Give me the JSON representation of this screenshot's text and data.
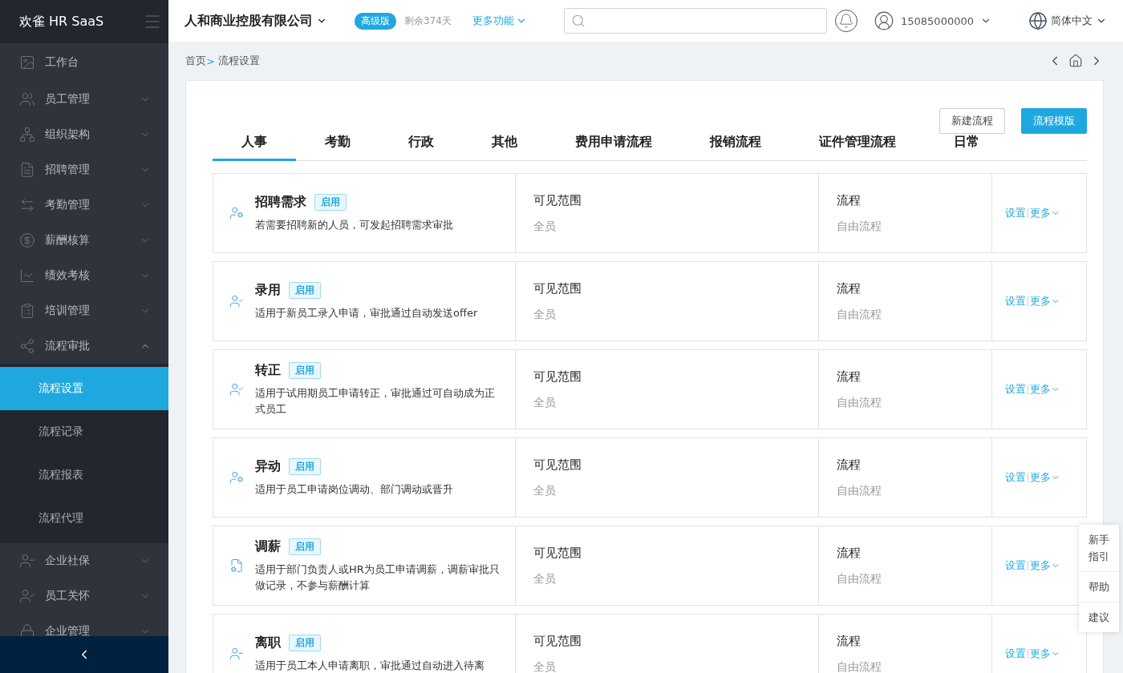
{
  "sidebar": {
    "logo": "欢雀 HR SaaS",
    "items": [
      {
        "label": "工作台"
      },
      {
        "label": "员工管理",
        "expanded": false
      },
      {
        "label": "组织架构",
        "expanded": false
      },
      {
        "label": "招聘管理",
        "expanded": false
      },
      {
        "label": "考勤管理",
        "expanded": false
      },
      {
        "label": "薪酬核算",
        "expanded": false
      },
      {
        "label": "绩效考核",
        "expanded": false
      },
      {
        "label": "培训管理",
        "expanded": false
      },
      {
        "label": "流程审批",
        "expanded": true,
        "children": [
          {
            "label": "流程设置",
            "selected": true
          },
          {
            "label": "流程记录",
            "selected": false
          },
          {
            "label": "流程报表",
            "selected": false
          },
          {
            "label": "流程代理",
            "selected": false
          }
        ]
      },
      {
        "label": "企业社保",
        "expanded": false
      },
      {
        "label": "员工关怀",
        "expanded": false
      },
      {
        "label": "企业管理",
        "expanded": false
      }
    ]
  },
  "header": {
    "company": "人和商业控股有限公司",
    "edition": "高级版",
    "remaining": "剩余374天",
    "more_features": "更多功能",
    "account": "15085000000",
    "language": "简体中文"
  },
  "breadcrumb": {
    "items": [
      "首页",
      "流程设置"
    ],
    "separator": ">"
  },
  "buttons": [
    {
      "label": "新建流程",
      "kind": "default"
    },
    {
      "label": "流程模版",
      "kind": "primary"
    }
  ],
  "tabs": [
    {
      "label": "人事",
      "selected": true
    },
    {
      "label": "考勤",
      "selected": false
    },
    {
      "label": "行政",
      "selected": false
    },
    {
      "label": "其他",
      "selected": false
    },
    {
      "label": "费用申请流程",
      "selected": false
    },
    {
      "label": "报销流程",
      "selected": false
    },
    {
      "label": "证件管理流程",
      "selected": false
    },
    {
      "label": "日常",
      "selected": false
    }
  ],
  "flows": [
    {
      "name": "招聘需求",
      "status": "启用",
      "description": "若需要招聘新的人员，可发起招聘需求审批",
      "scope_label": "可见范围",
      "scope": "全员",
      "type_label": "流程",
      "type": "自由流程",
      "actions": [
        "设置",
        "更多"
      ]
    },
    {
      "name": "录用",
      "status": "启用",
      "description": "适用于新员工录入申请，审批通过自动发送offer",
      "scope_label": "可见范围",
      "scope": "全员",
      "type_label": "流程",
      "type": "自由流程",
      "actions": [
        "设置",
        "更多"
      ]
    },
    {
      "name": "转正",
      "status": "启用",
      "description": "适用于试用期员工申请转正，审批通过可自动成为正式员工",
      "scope_label": "可见范围",
      "scope": "全员",
      "type_label": "流程",
      "type": "自由流程",
      "actions": [
        "设置",
        "更多"
      ]
    },
    {
      "name": "异动",
      "status": "启用",
      "description": "适用于员工申请岗位调动、部门调动或晋升",
      "scope_label": "可见范围",
      "scope": "全员",
      "type_label": "流程",
      "type": "自由流程",
      "actions": [
        "设置",
        "更多"
      ]
    },
    {
      "name": "调薪",
      "status": "启用",
      "description": "适用于部门负责人或HR为员工申请调薪，调薪审批只做记录，不参与薪酬计算",
      "scope_label": "可见范围",
      "scope": "全员",
      "type_label": "流程",
      "type": "自由流程",
      "actions": [
        "设置",
        "更多"
      ]
    },
    {
      "name": "离职",
      "status": "启用",
      "description": "适用于员工本人申请离职，审批通过自动进入待离",
      "scope_label": "可见范围",
      "scope": "全员",
      "type_label": "流程",
      "type": "自由流程",
      "actions": [
        "设置",
        "更多"
      ]
    }
  ],
  "help_panel": [
    "新手指引",
    "帮助",
    "建议"
  ]
}
